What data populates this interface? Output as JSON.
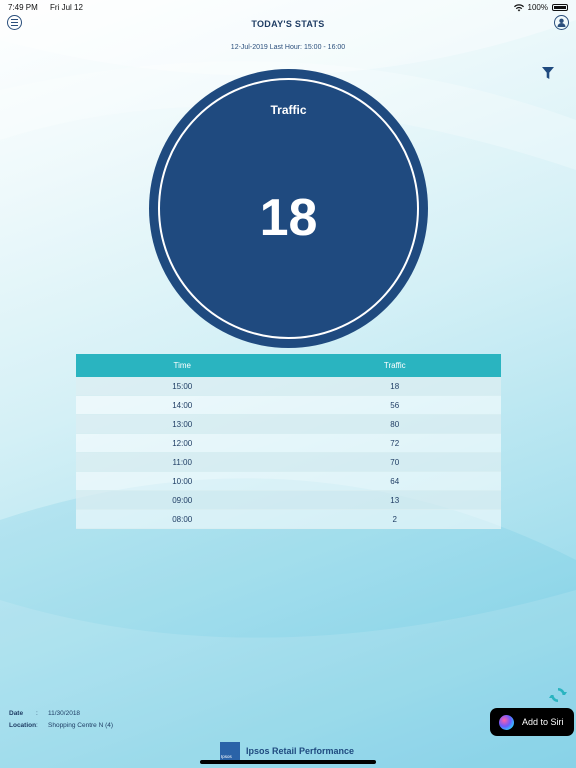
{
  "status_bar": {
    "time": "7:49 PM",
    "date": "Fri Jul 12",
    "battery": "100%"
  },
  "header": {
    "title": "TODAY'S STATS",
    "subtitle": "12-Jul-2019 Last Hour: 15:00 - 16:00"
  },
  "summary": {
    "label": "Traffic",
    "value": "18"
  },
  "table": {
    "headers": [
      "Time",
      "Traffic"
    ],
    "rows": [
      [
        "15:00",
        "18"
      ],
      [
        "14:00",
        "56"
      ],
      [
        "13:00",
        "80"
      ],
      [
        "12:00",
        "72"
      ],
      [
        "11:00",
        "70"
      ],
      [
        "10:00",
        "64"
      ],
      [
        "09:00",
        "13"
      ],
      [
        "08:00",
        "2"
      ]
    ]
  },
  "footer": {
    "date_label": "Date",
    "date_value": "11/30/2018",
    "location_label": "Location",
    "location_value": "Shopping Centre N (4)",
    "separator": ":"
  },
  "siri": {
    "label": "Add to Siri"
  },
  "brand": {
    "name": "Ipsos Retail Performance",
    "logo_text": "Ipsos"
  },
  "icons": {
    "menu": "menu-icon",
    "user": "user-icon",
    "filter": "filter-icon",
    "refresh": "refresh-icon",
    "wifi": "wifi-icon",
    "battery": "battery-icon"
  },
  "colors": {
    "primary": "#1f4a7f",
    "table_header": "#2ab4c0",
    "accent": "#2ab4c0"
  }
}
